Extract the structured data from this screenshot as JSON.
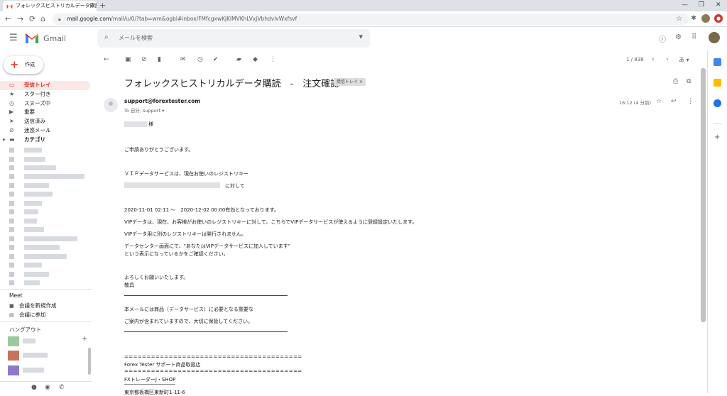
{
  "browser": {
    "tab_title": "フォレックスヒストリカルデータ購読",
    "tab_close": "×",
    "new_tab": "+",
    "url_host": "mail.google.com",
    "url_path": "/mail/u/0/?tab=wm&ogbl#inbox/FMfcgxwKjKlMVKhLVxjVbhdvlvWxfsvf",
    "back": "←",
    "forward": "→",
    "reload": "⟳",
    "home": "⌂",
    "bookmark": "☆",
    "minimize": "—",
    "maximize": "❐",
    "close": "✕"
  },
  "gmail": {
    "app_name": "Gmail",
    "search_placeholder": "メールを検索",
    "compose_label": "作成"
  },
  "sidebar": {
    "items": [
      {
        "label": "受信トレイ",
        "icon": "inbox-icon"
      },
      {
        "label": "スター付き",
        "icon": "star-icon"
      },
      {
        "label": "スヌーズ中",
        "icon": "clock-icon"
      },
      {
        "label": "重要",
        "icon": "label-important-icon"
      },
      {
        "label": "送信済み",
        "icon": "send-icon"
      },
      {
        "label": "迷惑メール",
        "icon": "alert-icon"
      },
      {
        "label": "カテゴリ",
        "icon": "label-icon"
      }
    ],
    "meet_title": "Meet",
    "meet_new": "会議を新規作成",
    "meet_join": "会議に参加",
    "hangouts_title": "ハングアウト"
  },
  "toolbar": {
    "pager": "1 / 838"
  },
  "message": {
    "subject": "フォレックスヒストリカルデータ購読　-　注文確認",
    "label_chip": "受信トレイ ×",
    "from": "support@forextester.com",
    "to": "To 自分, support ▾",
    "time": "16:12 (4 分前)",
    "body": {
      "salutation_suffix": "様",
      "thanks": "ご申請ありがとうございます。",
      "vip_intro": "ＶＩＰデータサービスは、現在お使いのレジストリキー",
      "vip_key_suffix": "に対して",
      "period": "2020-11-01 02:11 〜　2020-12-02 00:00有効となっております。",
      "vip_desc": "VIPデータは、現在、お客様がお使いのレジストリキーに対して、こちらでVIPデータサービスが使えるように登録設定いたします。",
      "no_separate_key": "VIPデータ用に別のレジストリキーは発行されません。",
      "datacenter_1": "データセンター画面にて、\"あなたはVIPデータサービスに加入しています\"",
      "datacenter_2": "という表示になっているかをご確認ください。",
      "regards": "よろしくお願いいたします。",
      "sign": "敬具",
      "important_1": "本メールには商品（データサービス）に必要となる重要な",
      "important_2": "ご案内が含まれていますので、大切に保管してください。",
      "separator_1": "========================================",
      "dealer": "Forex Tester サポート商品取扱店",
      "separator_2": "========================================",
      "shop": "FXトレーダーJ・SHOP",
      "address_partial": "東京都板橋区東新町1-11-6"
    }
  },
  "colors": {
    "gmail_red": "#d93025",
    "active_bg": "#fce8e6",
    "search_bg": "#f1f3f4"
  }
}
